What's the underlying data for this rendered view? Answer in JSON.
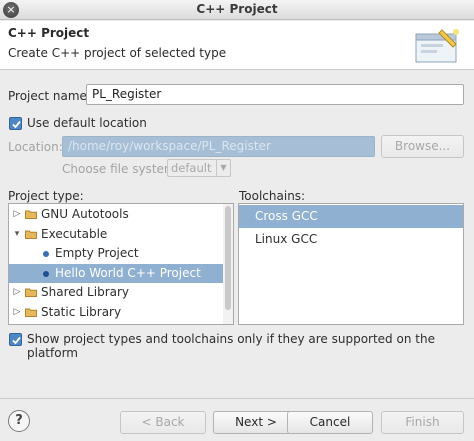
{
  "window": {
    "title": "C++ Project",
    "close_glyph": "×"
  },
  "header": {
    "title": "C++ Project",
    "description": "Create C++ project of selected type",
    "icon": "wizard-banner-icon"
  },
  "project_name": {
    "label": "Project name:",
    "value": "PL_Register"
  },
  "use_default_location": {
    "label": "Use default location",
    "checked": true
  },
  "location": {
    "label": "Location:",
    "value": "/home/roy/workspace/PL_Register",
    "browse_label": "Browse..."
  },
  "file_system": {
    "label": "Choose file system:",
    "value": "default"
  },
  "project_type": {
    "label": "Project type:",
    "items": [
      {
        "label": "GNU Autotools",
        "kind": "folder",
        "expanded": false,
        "level": 0
      },
      {
        "label": "Executable",
        "kind": "folder",
        "expanded": true,
        "level": 0
      },
      {
        "label": "Empty Project",
        "kind": "leaf",
        "level": 1
      },
      {
        "label": "Hello World C++ Project",
        "kind": "leaf",
        "level": 1,
        "selected": true
      },
      {
        "label": "Shared Library",
        "kind": "folder",
        "expanded": false,
        "level": 0
      },
      {
        "label": "Static Library",
        "kind": "folder",
        "expanded": false,
        "level": 0
      }
    ]
  },
  "toolchains": {
    "label": "Toolchains:",
    "items": [
      {
        "label": "Cross GCC",
        "selected": true
      },
      {
        "label": "Linux GCC",
        "selected": false
      }
    ]
  },
  "show_supported": {
    "label": "Show project types and toolchains only if they are supported on the platform",
    "checked": true
  },
  "buttons": {
    "help": "?",
    "back": "< Back",
    "next": "Next >",
    "cancel": "Cancel",
    "finish": "Finish"
  },
  "colors": {
    "selection": "#8fb0d0",
    "checkbox": "#4f86c4",
    "disabled_field": "#a7bfd6"
  }
}
